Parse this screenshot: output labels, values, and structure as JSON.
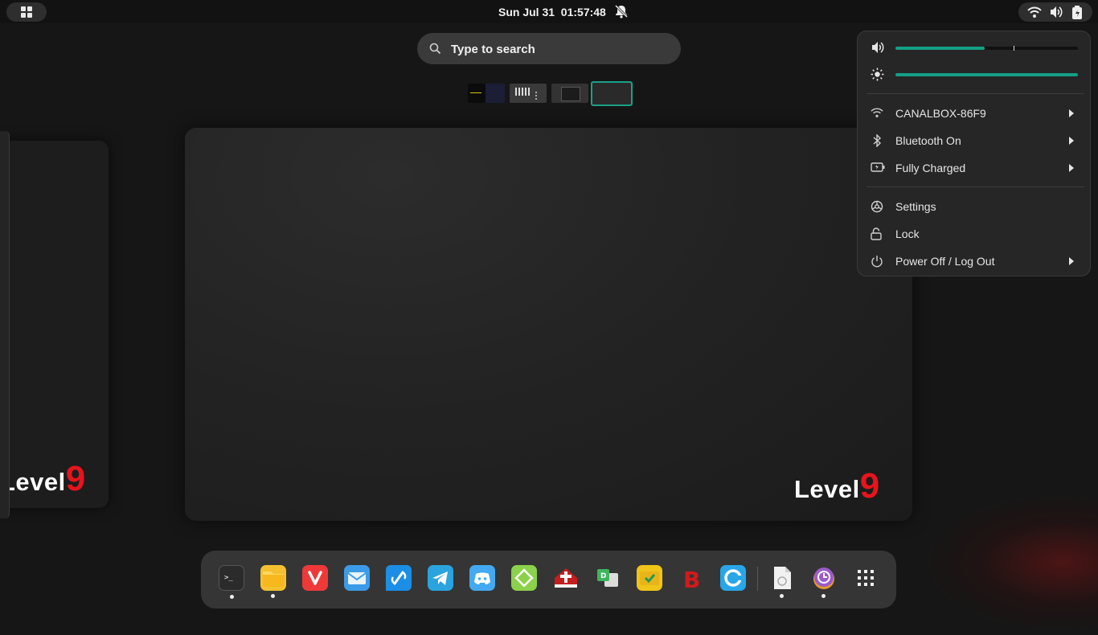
{
  "topbar": {
    "clock": "Sun Jul 31  01:57:48",
    "icons": [
      "activities-icon",
      "notifications-off-icon",
      "wifi-icon",
      "volume-icon",
      "battery-icon"
    ]
  },
  "search": {
    "placeholder": "Type to search"
  },
  "workspaces": {
    "count": 4,
    "active_index": 3
  },
  "wallpaper": {
    "logo_text": "Level",
    "logo_digit": "9"
  },
  "system_menu": {
    "volume_level": 0.49,
    "brightness_level": 1.0,
    "items": [
      {
        "label": "CANALBOX-86F9",
        "icon": "wifi-icon",
        "submenu": true
      },
      {
        "label": "Bluetooth On",
        "icon": "bluetooth-icon",
        "submenu": true
      },
      {
        "label": "Fully Charged",
        "icon": "battery-icon",
        "submenu": true
      },
      {
        "label": "Settings",
        "icon": "settings-icon",
        "submenu": false
      },
      {
        "label": "Lock",
        "icon": "lock-icon",
        "submenu": false
      },
      {
        "label": "Power Off / Log Out",
        "icon": "power-icon",
        "submenu": true
      }
    ]
  },
  "dock": {
    "apps": [
      {
        "name": "terminal",
        "icon": "terminal-icon",
        "running": true
      },
      {
        "name": "files",
        "icon": "folder-icon",
        "running": true
      },
      {
        "name": "vivaldi",
        "icon": "vivaldi-icon",
        "running": false
      },
      {
        "name": "mail",
        "icon": "mail-icon",
        "running": false
      },
      {
        "name": "chat",
        "icon": "chat-link-icon",
        "running": false
      },
      {
        "name": "telegram",
        "icon": "telegram-icon",
        "running": false
      },
      {
        "name": "discord",
        "icon": "discord-icon",
        "running": false
      },
      {
        "name": "sync",
        "icon": "sync-app-icon",
        "running": false
      },
      {
        "name": "bible",
        "icon": "bible-icon",
        "running": false
      },
      {
        "name": "dictionary",
        "icon": "dictionary-icon",
        "running": false
      },
      {
        "name": "todo",
        "icon": "checklist-icon",
        "running": false
      },
      {
        "name": "app-b",
        "icon": "b-app-icon",
        "running": false
      },
      {
        "name": "app-c",
        "icon": "c-app-icon",
        "running": false
      },
      {
        "name": "document",
        "icon": "document-icon",
        "running": true
      },
      {
        "name": "timeshift",
        "icon": "timeshift-icon",
        "running": true
      },
      {
        "name": "show-apps",
        "icon": "app-grid-icon",
        "running": false
      }
    ]
  },
  "colors": {
    "accent": "#13a085",
    "logo_red": "#e6141c",
    "panel": "#262626"
  }
}
